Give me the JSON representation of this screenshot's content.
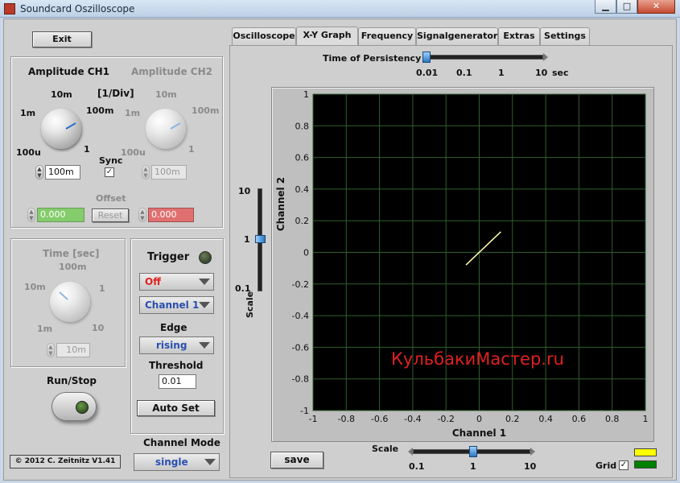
{
  "window": {
    "title": "Soundcard Oszilloscope",
    "min": "▁",
    "max": "□",
    "close": "✕"
  },
  "exit_label": "Exit",
  "amp": {
    "ch1_title": "Amplitude CH1",
    "ch2_title": "Amplitude CH2",
    "unit": "[1/Div]",
    "ticks": [
      "10m",
      "1m",
      "100m",
      "100u",
      "1"
    ],
    "ch1_value": "100m",
    "ch2_value": "100m",
    "sync_label": "Sync",
    "sync_checked": "✓",
    "offset_label": "Offset",
    "offset_ch1": "0.000",
    "offset_ch2": "0.000",
    "reset_label": "Reset"
  },
  "time": {
    "title": "Time [sec]",
    "ticks": [
      "100m",
      "10m",
      "1",
      "1m",
      "10"
    ],
    "value": "10m",
    "run_stop": "Run/Stop"
  },
  "trigger": {
    "title": "Trigger",
    "mode": "Off",
    "channel": "Channel 1",
    "edge_label": "Edge",
    "edge": "rising",
    "threshold_label": "Threshold",
    "threshold": "0.01",
    "autoset": "Auto Set"
  },
  "channel_mode": {
    "label": "Channel Mode",
    "value": "single"
  },
  "copyright": "© 2012  C. Zeitnitz V1.41",
  "tabs": [
    "Oscilloscope",
    "X-Y Graph",
    "Frequency",
    "Signalgenerator",
    "Extras",
    "Settings"
  ],
  "persistency": {
    "label": "Time of Persistency",
    "ticks": [
      "0.01",
      "0.1",
      "1",
      "10"
    ],
    "unit": "sec",
    "value": 0.01
  },
  "scale_v": {
    "label": "Scale",
    "ticks": [
      "10",
      "1",
      "0.1"
    ],
    "value": 1
  },
  "scale_h": {
    "label": "Scale",
    "ticks": [
      "0.1",
      "1",
      "10"
    ],
    "value": 1
  },
  "save_label": "save",
  "grid": {
    "label": "Grid",
    "checked": "✓"
  },
  "legend_colors": [
    "#ffff00",
    "#008000"
  ],
  "watermark": "КульбакиМастер.ru",
  "chart_data": {
    "type": "line",
    "xlabel": "Channel 1",
    "ylabel": "Channel 2",
    "xlim": [
      -1,
      1
    ],
    "ylim": [
      -1,
      1
    ],
    "xticks": [
      "-1",
      "-0.8",
      "-0.6",
      "-0.4",
      "-0.2",
      "0",
      "0.2",
      "0.4",
      "0.6",
      "0.8",
      "1"
    ],
    "yticks": [
      "1",
      "0.8",
      "0.6",
      "0.4",
      "0.2",
      "0",
      "-0.2",
      "-0.4",
      "-0.6",
      "-0.8",
      "-1"
    ],
    "grid": true,
    "series": [
      {
        "color": "#ffffaa",
        "x": [
          -0.08,
          0.13
        ],
        "y": [
          -0.08,
          0.13
        ]
      }
    ]
  }
}
